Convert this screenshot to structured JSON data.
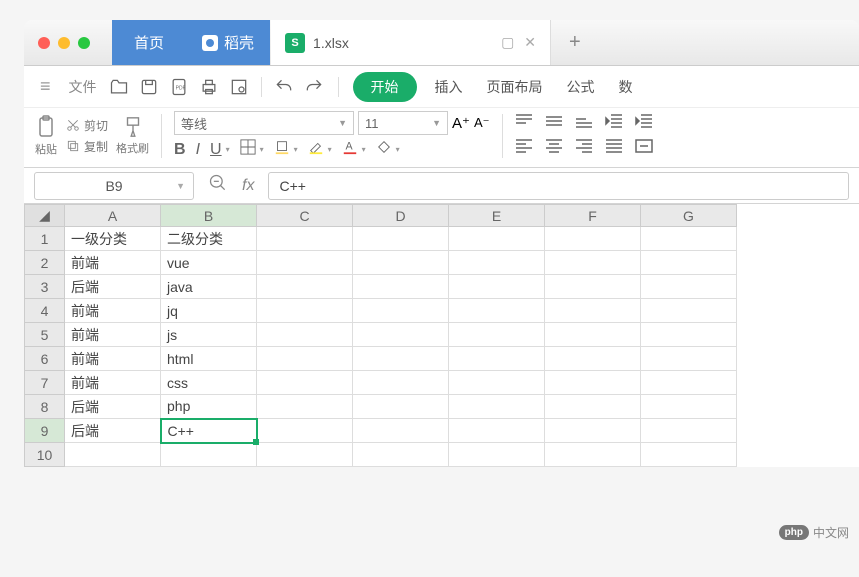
{
  "window": {
    "home_tab": "首页",
    "docer_tab": "稻壳",
    "file_tab": "1.xlsx",
    "file_icon_letter": "S"
  },
  "toolbar": {
    "file": "文件",
    "start": "开始",
    "insert": "插入",
    "page_layout": "页面布局",
    "formula": "公式",
    "data": "数",
    "paste": "粘贴",
    "cut": "剪切",
    "copy": "复制",
    "format_painter": "格式刷",
    "font_name": "等线",
    "font_size": "11",
    "bold": "B",
    "italic": "I",
    "underline": "U",
    "font_increase": "A⁺",
    "font_decrease": "A⁻"
  },
  "namebar": {
    "cell_ref": "B9",
    "fx_label": "fx",
    "formula_value": "C++"
  },
  "sheet": {
    "columns": [
      "A",
      "B",
      "C",
      "D",
      "E",
      "F",
      "G"
    ],
    "active_col": "B",
    "active_row": 9,
    "rows": [
      {
        "n": 1,
        "A": "一级分类",
        "B": "二级分类"
      },
      {
        "n": 2,
        "A": "前端",
        "B": "vue"
      },
      {
        "n": 3,
        "A": "后端",
        "B": "java"
      },
      {
        "n": 4,
        "A": "前端",
        "B": "jq"
      },
      {
        "n": 5,
        "A": "前端",
        "B": "js"
      },
      {
        "n": 6,
        "A": "前端",
        "B": "html"
      },
      {
        "n": 7,
        "A": "前端",
        "B": "css"
      },
      {
        "n": 8,
        "A": "后端",
        "B": "php"
      },
      {
        "n": 9,
        "A": "后端",
        "B": "C++"
      },
      {
        "n": 10,
        "A": "",
        "B": ""
      }
    ]
  },
  "watermark": {
    "logo": "php",
    "text": "中文网"
  }
}
